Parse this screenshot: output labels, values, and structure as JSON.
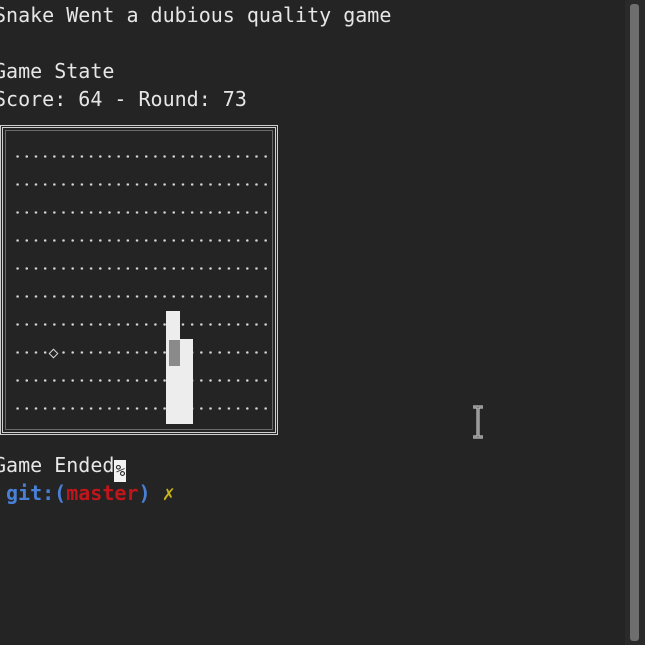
{
  "terminal": {
    "title_line": "Snake Went a dubious quality game",
    "state_heading": "Game State",
    "score_line": "Score: 64 - Round: 73",
    "ended_text": "Game Ended",
    "cursor_char": "%",
    "prompt": {
      "git_prefix": "git:(",
      "branch": "master",
      "git_suffix": ")",
      "dirty_mark": "✗"
    }
  },
  "game": {
    "score": 64,
    "round": 73,
    "grid_rows": 10,
    "grid_cols": 28,
    "food_symbol": "diamond",
    "snake_color": "#ededed"
  },
  "colors": {
    "background": "#242424",
    "text": "#e6e6e6",
    "git_blue": "#4a7fd6",
    "git_red": "#c0161b",
    "git_yellow": "#c9b317"
  },
  "icons": {
    "mouse_cursor": "ibeam-cursor-icon"
  }
}
